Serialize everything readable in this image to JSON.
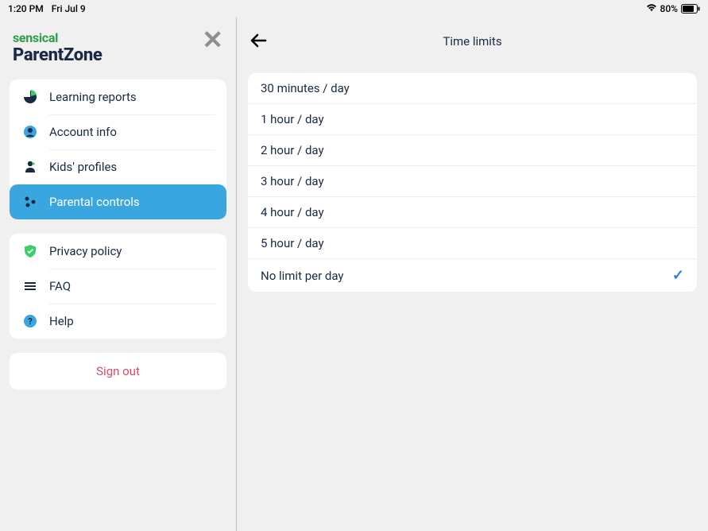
{
  "status": {
    "time": "1:20 PM",
    "date": "Fri Jul 9",
    "battery_pct": "80%"
  },
  "brand": {
    "top": "sensical",
    "bottom": "ParentZone"
  },
  "sidebar": {
    "group1": [
      {
        "id": "learning-reports",
        "label": "Learning reports",
        "icon": "pie",
        "active": false
      },
      {
        "id": "account-info",
        "label": "Account info",
        "icon": "user-circle",
        "active": false
      },
      {
        "id": "kids-profiles",
        "label": "Kids' profiles",
        "icon": "person",
        "active": false
      },
      {
        "id": "parental-controls",
        "label": "Parental controls",
        "icon": "dots",
        "active": true
      }
    ],
    "group2": [
      {
        "id": "privacy-policy",
        "label": "Privacy policy",
        "icon": "shield"
      },
      {
        "id": "faq",
        "label": "FAQ",
        "icon": "menu-lines"
      },
      {
        "id": "help",
        "label": "Help",
        "icon": "question"
      }
    ],
    "signout_label": "Sign out"
  },
  "content": {
    "title": "Time limits",
    "options": [
      {
        "label": "30 minutes / day",
        "selected": false
      },
      {
        "label": "1 hour / day",
        "selected": false
      },
      {
        "label": "2 hour / day",
        "selected": false
      },
      {
        "label": "3 hour / day",
        "selected": false
      },
      {
        "label": "4 hour / day",
        "selected": false
      },
      {
        "label": "5 hour / day",
        "selected": false
      },
      {
        "label": "No limit per day",
        "selected": true
      }
    ]
  }
}
